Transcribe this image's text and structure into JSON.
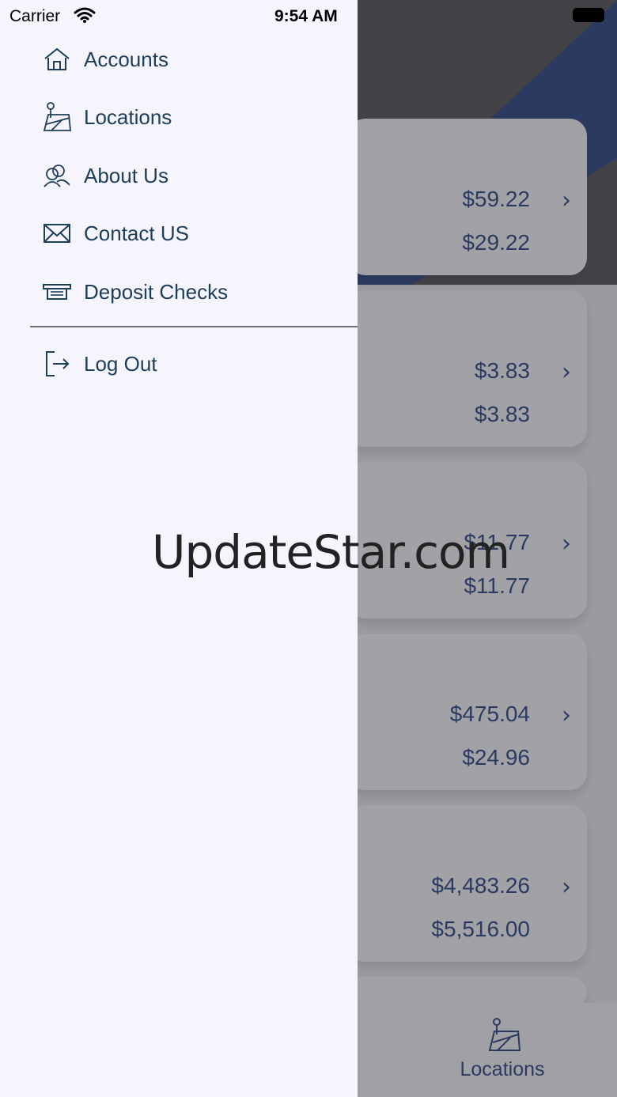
{
  "status_bar": {
    "carrier": "Carrier",
    "time": "9:54 AM"
  },
  "drawer": {
    "items": [
      {
        "label": "Accounts",
        "icon": "home-icon"
      },
      {
        "label": "Locations",
        "icon": "map-pin-icon"
      },
      {
        "label": "About Us",
        "icon": "people-icon"
      },
      {
        "label": "Contact US",
        "icon": "envelope-icon"
      },
      {
        "label": "Deposit Checks",
        "icon": "check-deposit-icon"
      }
    ],
    "logout": {
      "label": "Log Out",
      "icon": "logout-icon"
    }
  },
  "accounts": [
    {
      "balance": "$59.22",
      "available": "$29.22"
    },
    {
      "balance": "$3.83",
      "available": "$3.83"
    },
    {
      "balance": "$11.77",
      "available": "$11.77"
    },
    {
      "balance": "$475.04",
      "available": "$24.96"
    },
    {
      "balance": "$4,483.26",
      "available": "$5,516.00"
    }
  ],
  "tabbar": {
    "locations_label": "Locations"
  },
  "watermark": "UpdateStar.com",
  "colors": {
    "brand_navy": "#1d3a78",
    "drawer_text": "#1d3e5a",
    "drawer_bg": "#f6f4fd"
  }
}
